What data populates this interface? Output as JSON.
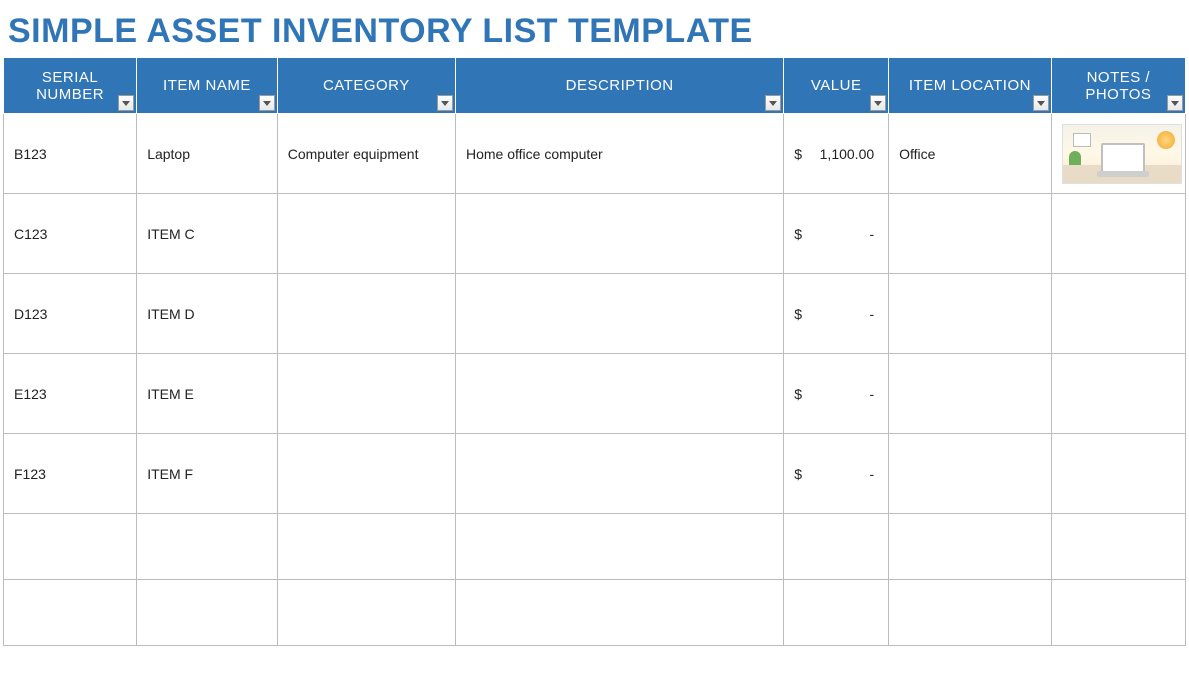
{
  "title": "SIMPLE ASSET INVENTORY LIST TEMPLATE",
  "columns": [
    {
      "key": "serial",
      "label": "SERIAL NUMBER"
    },
    {
      "key": "name",
      "label": "ITEM NAME"
    },
    {
      "key": "category",
      "label": "CATEGORY"
    },
    {
      "key": "desc",
      "label": "DESCRIPTION"
    },
    {
      "key": "value",
      "label": "VALUE"
    },
    {
      "key": "location",
      "label": "ITEM LOCATION"
    },
    {
      "key": "notes",
      "label": "NOTES / PHOTOS"
    }
  ],
  "currency_symbol": "$",
  "empty_value_display": "-",
  "rows": [
    {
      "serial": "B123",
      "name": "Laptop",
      "category": "Computer equipment",
      "desc": "Home office computer",
      "value": "1,100.00",
      "location": "Office",
      "has_photo": true,
      "photo_name": "laptop-desk-photo"
    },
    {
      "serial": "C123",
      "name": "ITEM C",
      "category": "",
      "desc": "",
      "value": "",
      "location": "",
      "has_photo": false
    },
    {
      "serial": "D123",
      "name": "ITEM D",
      "category": "",
      "desc": "",
      "value": "",
      "location": "",
      "has_photo": false
    },
    {
      "serial": "E123",
      "name": "ITEM E",
      "category": "",
      "desc": "",
      "value": "",
      "location": "",
      "has_photo": false
    },
    {
      "serial": "F123",
      "name": "ITEM F",
      "category": "",
      "desc": "",
      "value": "",
      "location": "",
      "has_photo": false
    },
    {
      "serial": "",
      "name": "",
      "category": "",
      "desc": "",
      "value": null,
      "location": "",
      "has_photo": false
    },
    {
      "serial": "",
      "name": "",
      "category": "",
      "desc": "",
      "value": null,
      "location": "",
      "has_photo": false
    }
  ],
  "colors": {
    "header_bg": "#3075b6",
    "title_color": "#3075b6",
    "grid_border": "#bcbcbc"
  }
}
